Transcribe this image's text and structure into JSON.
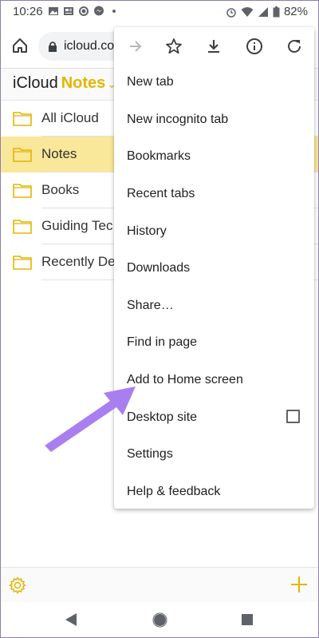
{
  "status_bar": {
    "time": "10:26",
    "battery": "82%",
    "icons_left": [
      "photo-icon",
      "news-icon",
      "whatsapp-icon",
      "messenger-icon",
      "dot-icon"
    ],
    "icons_right": [
      "alarm-icon",
      "wifi-icon",
      "signal-icon",
      "battery-icon"
    ]
  },
  "browser": {
    "url": "icloud.co",
    "menu_toolbar": [
      "forward-icon",
      "star-icon",
      "download-icon",
      "info-icon",
      "refresh-icon"
    ],
    "menu_items": [
      {
        "label": "New tab"
      },
      {
        "label": "New incognito tab"
      },
      {
        "label": "Bookmarks"
      },
      {
        "label": "Recent tabs"
      },
      {
        "label": "History"
      },
      {
        "label": "Downloads"
      },
      {
        "label": "Share…"
      },
      {
        "label": "Find in page"
      },
      {
        "label": "Add to Home screen"
      },
      {
        "label": "Desktop site",
        "checkbox": false
      },
      {
        "label": "Settings"
      },
      {
        "label": "Help & feedback"
      }
    ]
  },
  "app": {
    "brand_icloud": "iCloud",
    "brand_notes": "Notes",
    "folders": [
      {
        "label": "All iCloud",
        "selected": false
      },
      {
        "label": "Notes",
        "selected": true
      },
      {
        "label": "Books",
        "selected": false
      },
      {
        "label": "Guiding Tec",
        "selected": false
      },
      {
        "label": "Recently De",
        "selected": false
      }
    ]
  },
  "colors": {
    "accent": "#e3b500",
    "selected_row": "#f9e79a",
    "arrow": "#a97ff0"
  }
}
